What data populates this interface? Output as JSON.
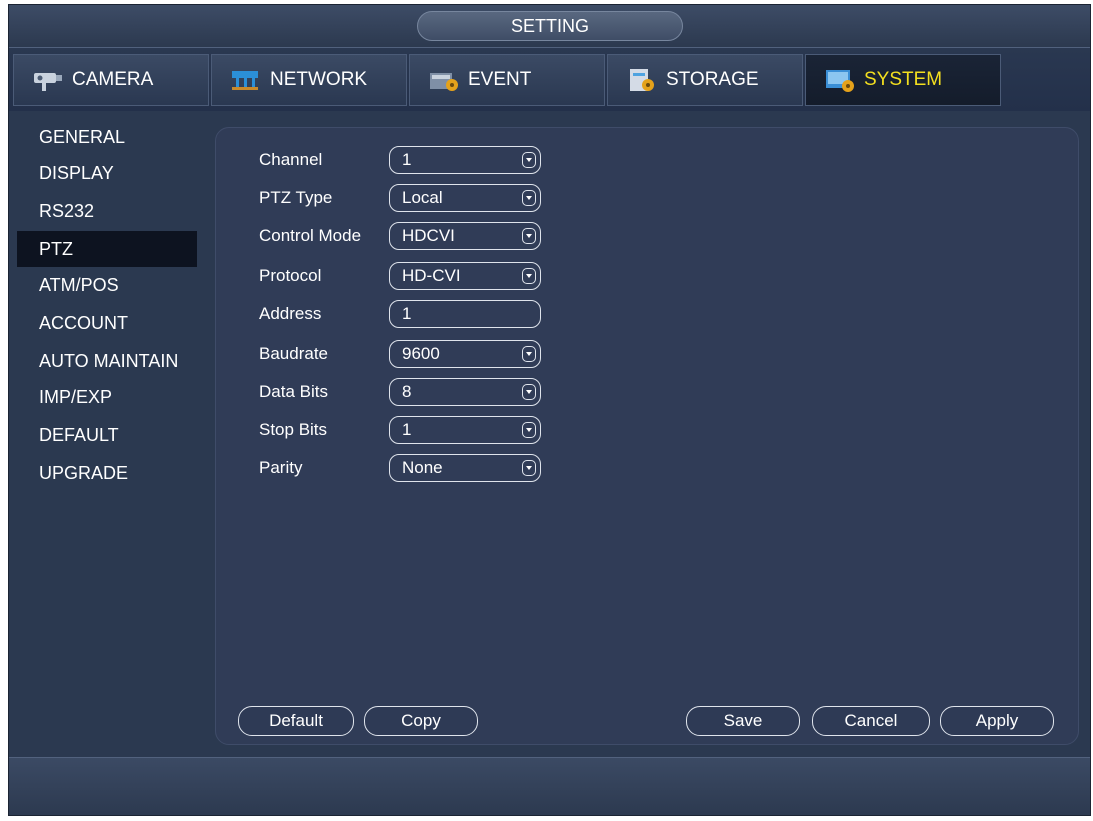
{
  "title": "SETTING",
  "tabs": [
    {
      "label": "CAMERA",
      "icon": "camera-icon"
    },
    {
      "label": "NETWORK",
      "icon": "network-icon"
    },
    {
      "label": "EVENT",
      "icon": "event-icon"
    },
    {
      "label": "STORAGE",
      "icon": "storage-icon"
    },
    {
      "label": "SYSTEM",
      "icon": "system-icon",
      "active": true
    }
  ],
  "sidebar": {
    "items": [
      {
        "label": "GENERAL"
      },
      {
        "label": "DISPLAY"
      },
      {
        "label": "RS232"
      },
      {
        "label": "PTZ",
        "active": true
      },
      {
        "label": "ATM/POS"
      },
      {
        "label": "ACCOUNT"
      },
      {
        "label": "AUTO MAINTAIN"
      },
      {
        "label": "IMP/EXP"
      },
      {
        "label": "DEFAULT"
      },
      {
        "label": "UPGRADE"
      }
    ]
  },
  "form": {
    "fields": [
      {
        "label": "Channel",
        "value": "1",
        "dropdown": true
      },
      {
        "label": "PTZ Type",
        "value": "Local",
        "dropdown": true
      },
      {
        "label": "Control Mode",
        "value": "HDCVI",
        "dropdown": true
      },
      {
        "label": "Protocol",
        "value": "HD-CVI",
        "dropdown": true
      },
      {
        "label": "Address",
        "value": "1",
        "dropdown": false
      },
      {
        "label": "Baudrate",
        "value": "9600",
        "dropdown": true
      },
      {
        "label": "Data Bits",
        "value": "8",
        "dropdown": true
      },
      {
        "label": "Stop Bits",
        "value": "1",
        "dropdown": true
      },
      {
        "label": "Parity",
        "value": "None",
        "dropdown": true
      }
    ]
  },
  "buttons": {
    "default": "Default",
    "copy": "Copy",
    "save": "Save",
    "cancel": "Cancel",
    "apply": "Apply"
  },
  "colors": {
    "background": "#2b3950",
    "panel": "#303c57",
    "active_tab_text": "#f3df1f",
    "text": "#ffffff"
  }
}
